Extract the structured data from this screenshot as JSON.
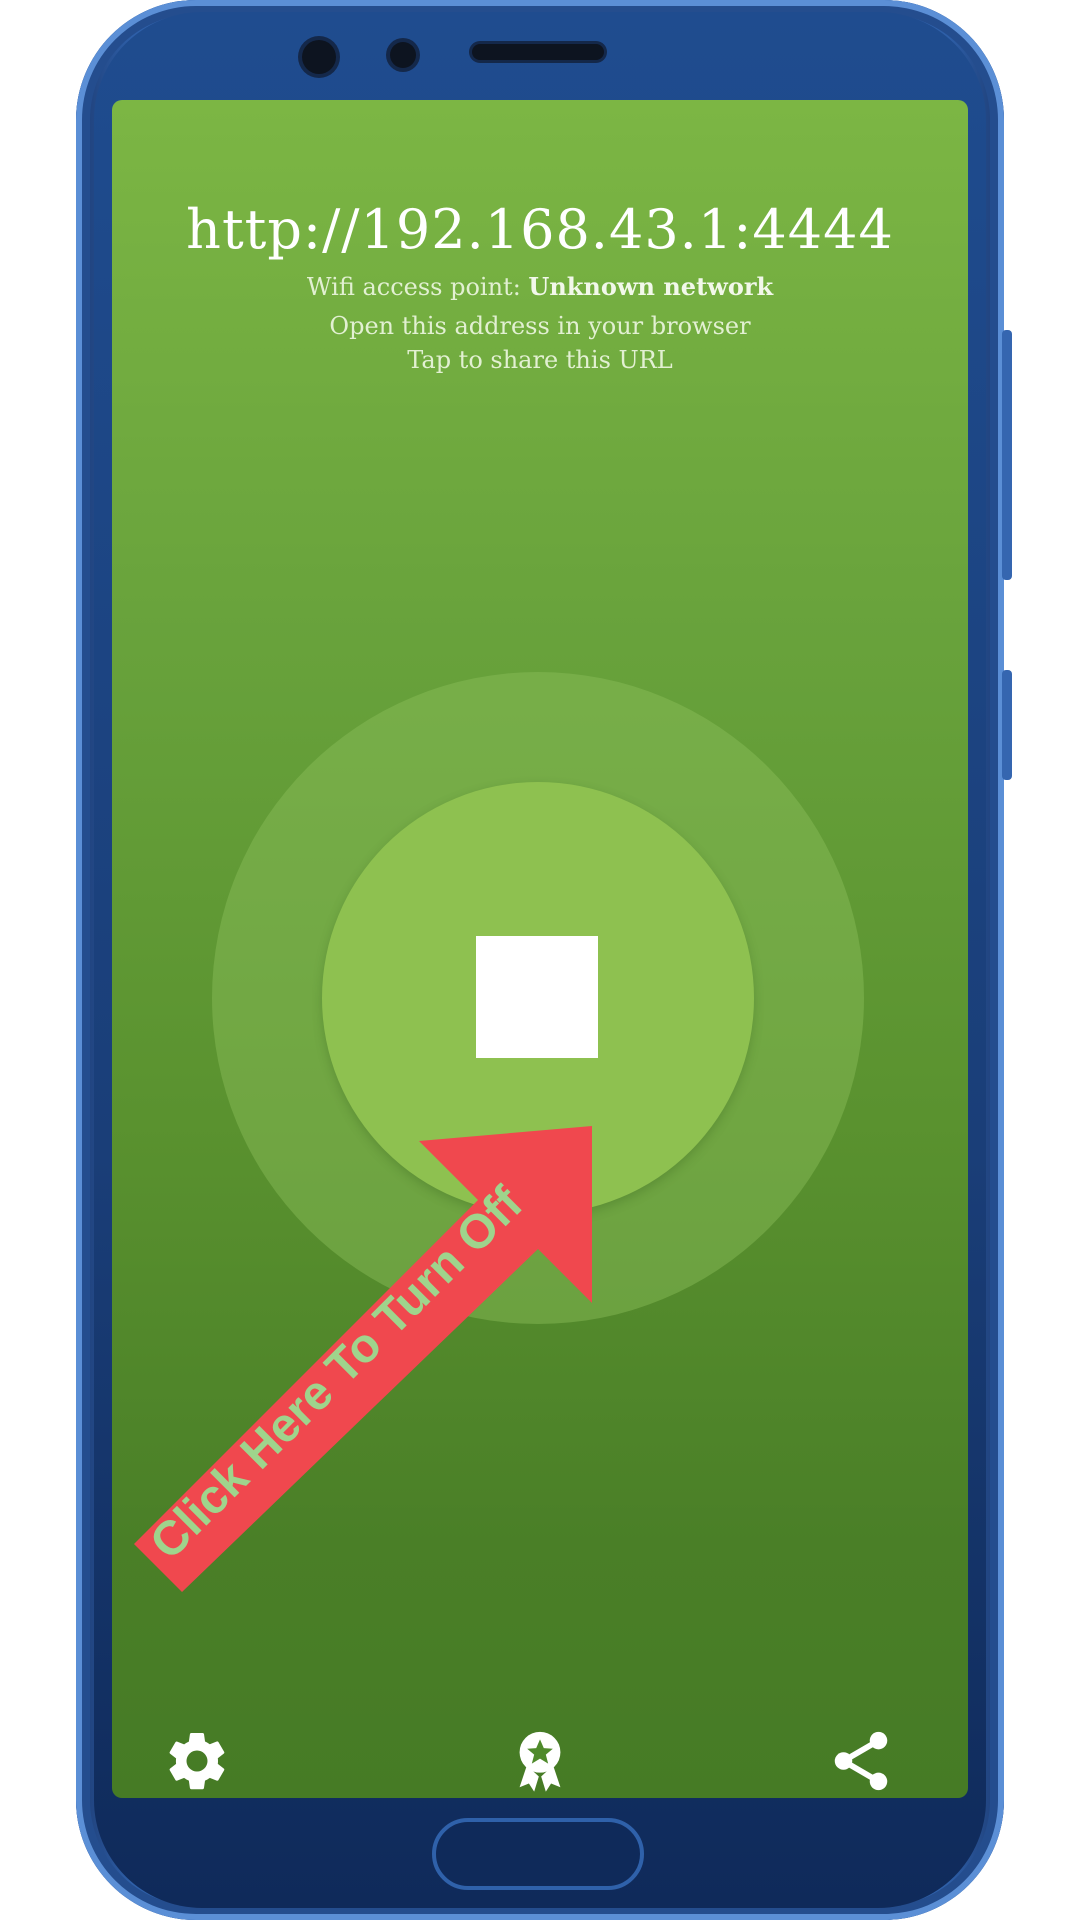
{
  "server": {
    "url": "http://192.168.43.1:4444",
    "wifi_label": "Wifi access point:",
    "wifi_network": "Unknown network",
    "instruction": "Open this address in your browser",
    "share_hint": "Tap to share this URL"
  },
  "controls": {
    "stop_button_icon": "stop-icon"
  },
  "bottom_bar": {
    "settings_icon": "gear-icon",
    "badge_icon": "award-ribbon-icon",
    "share_icon": "share-icon"
  },
  "annotation": {
    "text": "Click Here To Turn Off",
    "arrow_color": "#f0484e",
    "text_color": "#9fd48c"
  },
  "colors": {
    "screen_top": "#7cb644",
    "screen_bottom": "#467b25",
    "phone_body": "#2e5fa8"
  }
}
